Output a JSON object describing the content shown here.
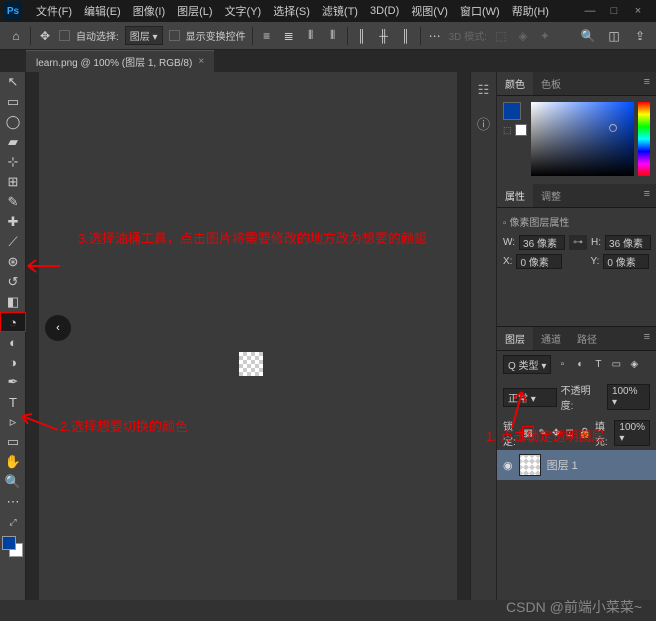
{
  "menu": [
    "文件(F)",
    "编辑(E)",
    "图像(I)",
    "图层(L)",
    "文字(Y)",
    "选择(S)",
    "滤镜(T)",
    "3D(D)",
    "视图(V)",
    "窗口(W)",
    "帮助(H)"
  ],
  "win_controls": {
    "min": "—",
    "max": "□",
    "close": "×"
  },
  "options": {
    "auto_select": "自动选择:",
    "layer": "图层",
    "show_controls": "显示变换控件",
    "mode3d": "3D 模式:"
  },
  "doc_tab": {
    "title": "learn.png @ 100% (图层 1, RGB/8)",
    "close": "×"
  },
  "back_icon": "‹",
  "panels": {
    "color_tabs": [
      "颜色",
      "色板"
    ],
    "prop_tabs": [
      "属性",
      "调整"
    ],
    "prop_title": "像素图层属性",
    "w_label": "W:",
    "w_val": "36 像素",
    "h_label": "H:",
    "h_val": "36 像素",
    "x_label": "X:",
    "x_val": "0 像素",
    "y_label": "Y:",
    "y_val": "0 像素",
    "layer_tabs": [
      "图层",
      "通道",
      "路径"
    ],
    "kind": "Q 类型",
    "blend": "正常",
    "opacity_label": "不透明度:",
    "opacity_val": "100%",
    "lock_label": "锁定:",
    "fill_label": "填充:",
    "fill_val": "100%",
    "layer_name": "图层 1"
  },
  "annotations": {
    "a1": "1. 点击锁定透明图层",
    "a2": "2.选择想要切换的颜色",
    "a3": "3.选择油桶工具，点击图片将需要修改的地方改为想要的颜鉅"
  },
  "watermark": "CSDN @前端小菜菜~",
  "tools": [
    "↖",
    "▭",
    "◯",
    "▰",
    "⊹",
    "✂",
    "✎",
    "↗",
    "⟋",
    "✐",
    "⬡",
    "✎",
    "◔",
    "◐",
    "T",
    "▹",
    "◘",
    "✋",
    "🔍",
    "⋯"
  ]
}
